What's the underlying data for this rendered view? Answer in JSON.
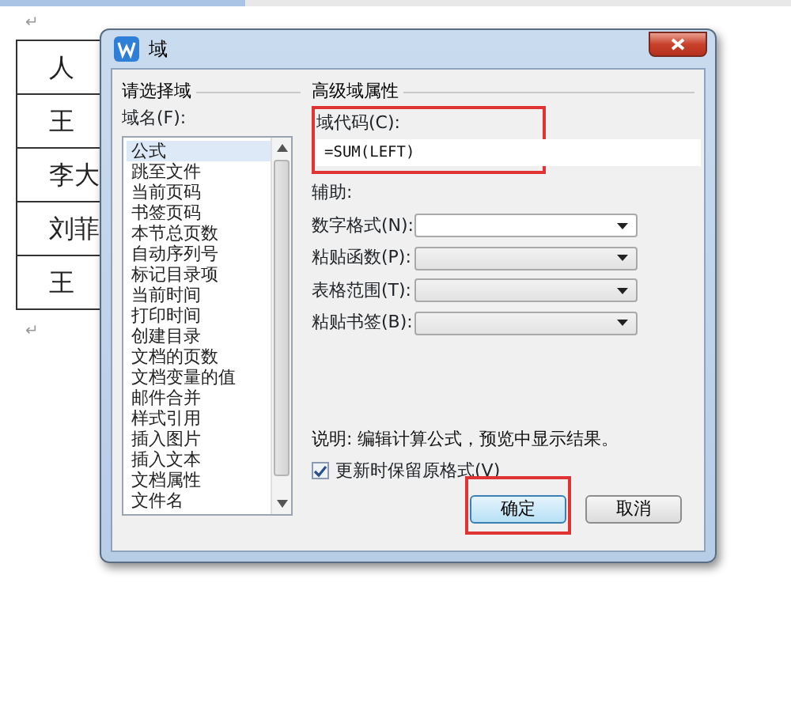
{
  "document": {
    "mark_before": "↵",
    "table_rows": [
      "人",
      "王",
      "李大",
      "刘菲",
      "王"
    ],
    "mark_after": "↵"
  },
  "dialog": {
    "title": "域",
    "left_group": {
      "title": "请选择域",
      "list_label": "域名(F):",
      "items": [
        {
          "label": "公式",
          "selected": true
        },
        {
          "label": "跳至文件",
          "selected": false
        },
        {
          "label": "当前页码",
          "selected": false
        },
        {
          "label": "书签页码",
          "selected": false
        },
        {
          "label": "本节总页数",
          "selected": false
        },
        {
          "label": "自动序列号",
          "selected": false
        },
        {
          "label": "标记目录项",
          "selected": false
        },
        {
          "label": "当前时间",
          "selected": false
        },
        {
          "label": "打印时间",
          "selected": false
        },
        {
          "label": "创建目录",
          "selected": false
        },
        {
          "label": "文档的页数",
          "selected": false
        },
        {
          "label": "文档变量的值",
          "selected": false
        },
        {
          "label": "邮件合并",
          "selected": false
        },
        {
          "label": "样式引用",
          "selected": false
        },
        {
          "label": "插入图片",
          "selected": false
        },
        {
          "label": "插入文本",
          "selected": false
        },
        {
          "label": "文档属性",
          "selected": false
        },
        {
          "label": "文件名",
          "selected": false
        }
      ]
    },
    "right_group": {
      "title": "高级域属性",
      "code_label": "域代码(C):",
      "code_value": "=SUM(LEFT)",
      "code_highlighted": true,
      "helper_label": "辅助:",
      "selects": [
        {
          "label": "数字格式(N):",
          "disabled": false
        },
        {
          "label": "粘贴函数(P):",
          "disabled": true
        },
        {
          "label": "表格范围(T):",
          "disabled": true
        },
        {
          "label": "粘贴书签(B):",
          "disabled": true
        }
      ],
      "description": "说明: 编辑计算公式，预览中显示结果。",
      "checkbox": {
        "label": "更新时保留原格式(V)",
        "checked": true
      }
    },
    "buttons": [
      {
        "label": "确定",
        "default": true,
        "highlighted": true
      },
      {
        "label": "取消",
        "default": false,
        "highlighted": false
      }
    ]
  }
}
